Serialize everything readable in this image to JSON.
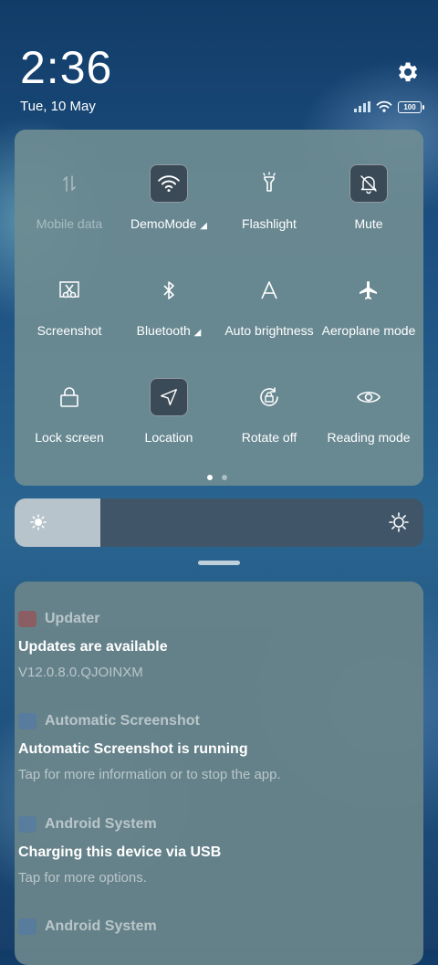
{
  "status": {
    "time": "2:36",
    "date": "Tue, 10 May",
    "battery_level": "100",
    "icons": [
      "signal-icon",
      "wifi-icon",
      "battery-icon"
    ]
  },
  "quick_settings": {
    "tiles": [
      {
        "label": "Mobile data",
        "icon": "mobile-data-icon",
        "active": false,
        "disabled": true
      },
      {
        "label": "DemoMode",
        "icon": "wifi-icon",
        "active": true,
        "expandable": true
      },
      {
        "label": "Flashlight",
        "icon": "flashlight-icon",
        "active": false
      },
      {
        "label": "Mute",
        "icon": "bell-off-icon",
        "active": true
      },
      {
        "label": "Screenshot",
        "icon": "scissors-icon",
        "active": false
      },
      {
        "label": "Bluetooth",
        "icon": "bluetooth-icon",
        "active": false,
        "expandable": true
      },
      {
        "label": "Auto brightness",
        "icon": "auto-brightness-icon",
        "active": false
      },
      {
        "label": "Aeroplane mode",
        "icon": "airplane-icon",
        "active": false
      },
      {
        "label": "Lock screen",
        "icon": "lock-icon",
        "active": false
      },
      {
        "label": "Location",
        "icon": "location-icon",
        "active": true
      },
      {
        "label": "Rotate off",
        "icon": "rotate-lock-icon",
        "active": false
      },
      {
        "label": "Reading mode",
        "icon": "eye-icon",
        "active": false
      }
    ],
    "page_count": 2,
    "current_page": 1
  },
  "brightness": {
    "level": 0.21
  },
  "notifications": [
    {
      "app": "Updater",
      "title": "Updates are available",
      "text": "V12.0.8.0.QJOINXM",
      "icon_color": "#b03a3a"
    },
    {
      "app": "Automatic Screenshot",
      "title": "Automatic Screenshot is running",
      "text": "Tap for more information or to stop the app.",
      "icon_color": "#4a78b0"
    },
    {
      "app": "Android System",
      "title": "Charging this device via USB",
      "text": "Tap for more options.",
      "icon_color": "#4a78b0"
    },
    {
      "app": "Android System",
      "title": "",
      "text": "",
      "icon_color": "#4a78b0"
    }
  ],
  "colors": {
    "panel": "#6e8c92",
    "active_tile": "#3a4a56"
  }
}
